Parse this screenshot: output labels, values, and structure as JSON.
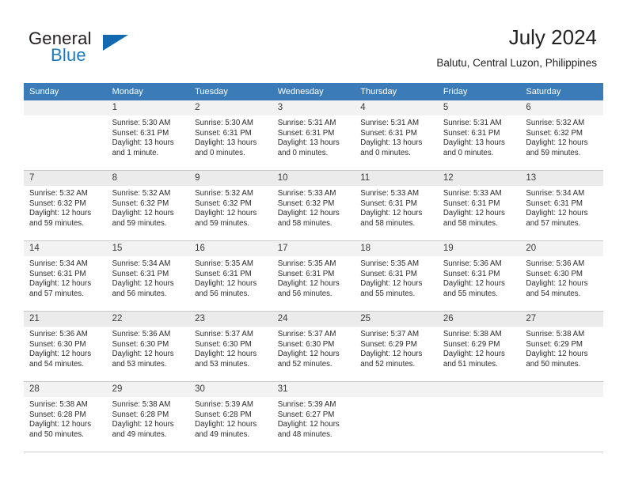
{
  "brand": {
    "name_dark": "General",
    "name_light": "Blue",
    "accent_color": "#1269b0"
  },
  "header": {
    "title": "July 2024",
    "subtitle": "Balutu, Central Luzon, Philippines"
  },
  "calendar": {
    "header_bg": "#3b7cb8",
    "weekdays": [
      "Sunday",
      "Monday",
      "Tuesday",
      "Wednesday",
      "Thursday",
      "Friday",
      "Saturday"
    ],
    "weeks": [
      [
        {
          "day": "",
          "sunrise": "",
          "sunset": "",
          "daylight_line1": "",
          "daylight_line2": ""
        },
        {
          "day": "1",
          "sunrise": "Sunrise: 5:30 AM",
          "sunset": "Sunset: 6:31 PM",
          "daylight_line1": "Daylight: 13 hours",
          "daylight_line2": "and 1 minute."
        },
        {
          "day": "2",
          "sunrise": "Sunrise: 5:30 AM",
          "sunset": "Sunset: 6:31 PM",
          "daylight_line1": "Daylight: 13 hours",
          "daylight_line2": "and 0 minutes."
        },
        {
          "day": "3",
          "sunrise": "Sunrise: 5:31 AM",
          "sunset": "Sunset: 6:31 PM",
          "daylight_line1": "Daylight: 13 hours",
          "daylight_line2": "and 0 minutes."
        },
        {
          "day": "4",
          "sunrise": "Sunrise: 5:31 AM",
          "sunset": "Sunset: 6:31 PM",
          "daylight_line1": "Daylight: 13 hours",
          "daylight_line2": "and 0 minutes."
        },
        {
          "day": "5",
          "sunrise": "Sunrise: 5:31 AM",
          "sunset": "Sunset: 6:31 PM",
          "daylight_line1": "Daylight: 13 hours",
          "daylight_line2": "and 0 minutes."
        },
        {
          "day": "6",
          "sunrise": "Sunrise: 5:32 AM",
          "sunset": "Sunset: 6:32 PM",
          "daylight_line1": "Daylight: 12 hours",
          "daylight_line2": "and 59 minutes."
        }
      ],
      [
        {
          "day": "7",
          "sunrise": "Sunrise: 5:32 AM",
          "sunset": "Sunset: 6:32 PM",
          "daylight_line1": "Daylight: 12 hours",
          "daylight_line2": "and 59 minutes."
        },
        {
          "day": "8",
          "sunrise": "Sunrise: 5:32 AM",
          "sunset": "Sunset: 6:32 PM",
          "daylight_line1": "Daylight: 12 hours",
          "daylight_line2": "and 59 minutes."
        },
        {
          "day": "9",
          "sunrise": "Sunrise: 5:32 AM",
          "sunset": "Sunset: 6:32 PM",
          "daylight_line1": "Daylight: 12 hours",
          "daylight_line2": "and 59 minutes."
        },
        {
          "day": "10",
          "sunrise": "Sunrise: 5:33 AM",
          "sunset": "Sunset: 6:32 PM",
          "daylight_line1": "Daylight: 12 hours",
          "daylight_line2": "and 58 minutes."
        },
        {
          "day": "11",
          "sunrise": "Sunrise: 5:33 AM",
          "sunset": "Sunset: 6:31 PM",
          "daylight_line1": "Daylight: 12 hours",
          "daylight_line2": "and 58 minutes."
        },
        {
          "day": "12",
          "sunrise": "Sunrise: 5:33 AM",
          "sunset": "Sunset: 6:31 PM",
          "daylight_line1": "Daylight: 12 hours",
          "daylight_line2": "and 58 minutes."
        },
        {
          "day": "13",
          "sunrise": "Sunrise: 5:34 AM",
          "sunset": "Sunset: 6:31 PM",
          "daylight_line1": "Daylight: 12 hours",
          "daylight_line2": "and 57 minutes."
        }
      ],
      [
        {
          "day": "14",
          "sunrise": "Sunrise: 5:34 AM",
          "sunset": "Sunset: 6:31 PM",
          "daylight_line1": "Daylight: 12 hours",
          "daylight_line2": "and 57 minutes."
        },
        {
          "day": "15",
          "sunrise": "Sunrise: 5:34 AM",
          "sunset": "Sunset: 6:31 PM",
          "daylight_line1": "Daylight: 12 hours",
          "daylight_line2": "and 56 minutes."
        },
        {
          "day": "16",
          "sunrise": "Sunrise: 5:35 AM",
          "sunset": "Sunset: 6:31 PM",
          "daylight_line1": "Daylight: 12 hours",
          "daylight_line2": "and 56 minutes."
        },
        {
          "day": "17",
          "sunrise": "Sunrise: 5:35 AM",
          "sunset": "Sunset: 6:31 PM",
          "daylight_line1": "Daylight: 12 hours",
          "daylight_line2": "and 56 minutes."
        },
        {
          "day": "18",
          "sunrise": "Sunrise: 5:35 AM",
          "sunset": "Sunset: 6:31 PM",
          "daylight_line1": "Daylight: 12 hours",
          "daylight_line2": "and 55 minutes."
        },
        {
          "day": "19",
          "sunrise": "Sunrise: 5:36 AM",
          "sunset": "Sunset: 6:31 PM",
          "daylight_line1": "Daylight: 12 hours",
          "daylight_line2": "and 55 minutes."
        },
        {
          "day": "20",
          "sunrise": "Sunrise: 5:36 AM",
          "sunset": "Sunset: 6:30 PM",
          "daylight_line1": "Daylight: 12 hours",
          "daylight_line2": "and 54 minutes."
        }
      ],
      [
        {
          "day": "21",
          "sunrise": "Sunrise: 5:36 AM",
          "sunset": "Sunset: 6:30 PM",
          "daylight_line1": "Daylight: 12 hours",
          "daylight_line2": "and 54 minutes."
        },
        {
          "day": "22",
          "sunrise": "Sunrise: 5:36 AM",
          "sunset": "Sunset: 6:30 PM",
          "daylight_line1": "Daylight: 12 hours",
          "daylight_line2": "and 53 minutes."
        },
        {
          "day": "23",
          "sunrise": "Sunrise: 5:37 AM",
          "sunset": "Sunset: 6:30 PM",
          "daylight_line1": "Daylight: 12 hours",
          "daylight_line2": "and 53 minutes."
        },
        {
          "day": "24",
          "sunrise": "Sunrise: 5:37 AM",
          "sunset": "Sunset: 6:30 PM",
          "daylight_line1": "Daylight: 12 hours",
          "daylight_line2": "and 52 minutes."
        },
        {
          "day": "25",
          "sunrise": "Sunrise: 5:37 AM",
          "sunset": "Sunset: 6:29 PM",
          "daylight_line1": "Daylight: 12 hours",
          "daylight_line2": "and 52 minutes."
        },
        {
          "day": "26",
          "sunrise": "Sunrise: 5:38 AM",
          "sunset": "Sunset: 6:29 PM",
          "daylight_line1": "Daylight: 12 hours",
          "daylight_line2": "and 51 minutes."
        },
        {
          "day": "27",
          "sunrise": "Sunrise: 5:38 AM",
          "sunset": "Sunset: 6:29 PM",
          "daylight_line1": "Daylight: 12 hours",
          "daylight_line2": "and 50 minutes."
        }
      ],
      [
        {
          "day": "28",
          "sunrise": "Sunrise: 5:38 AM",
          "sunset": "Sunset: 6:28 PM",
          "daylight_line1": "Daylight: 12 hours",
          "daylight_line2": "and 50 minutes."
        },
        {
          "day": "29",
          "sunrise": "Sunrise: 5:38 AM",
          "sunset": "Sunset: 6:28 PM",
          "daylight_line1": "Daylight: 12 hours",
          "daylight_line2": "and 49 minutes."
        },
        {
          "day": "30",
          "sunrise": "Sunrise: 5:39 AM",
          "sunset": "Sunset: 6:28 PM",
          "daylight_line1": "Daylight: 12 hours",
          "daylight_line2": "and 49 minutes."
        },
        {
          "day": "31",
          "sunrise": "Sunrise: 5:39 AM",
          "sunset": "Sunset: 6:27 PM",
          "daylight_line1": "Daylight: 12 hours",
          "daylight_line2": "and 48 minutes."
        },
        {
          "day": "",
          "sunrise": "",
          "sunset": "",
          "daylight_line1": "",
          "daylight_line2": ""
        },
        {
          "day": "",
          "sunrise": "",
          "sunset": "",
          "daylight_line1": "",
          "daylight_line2": ""
        },
        {
          "day": "",
          "sunrise": "",
          "sunset": "",
          "daylight_line1": "",
          "daylight_line2": ""
        }
      ]
    ]
  }
}
